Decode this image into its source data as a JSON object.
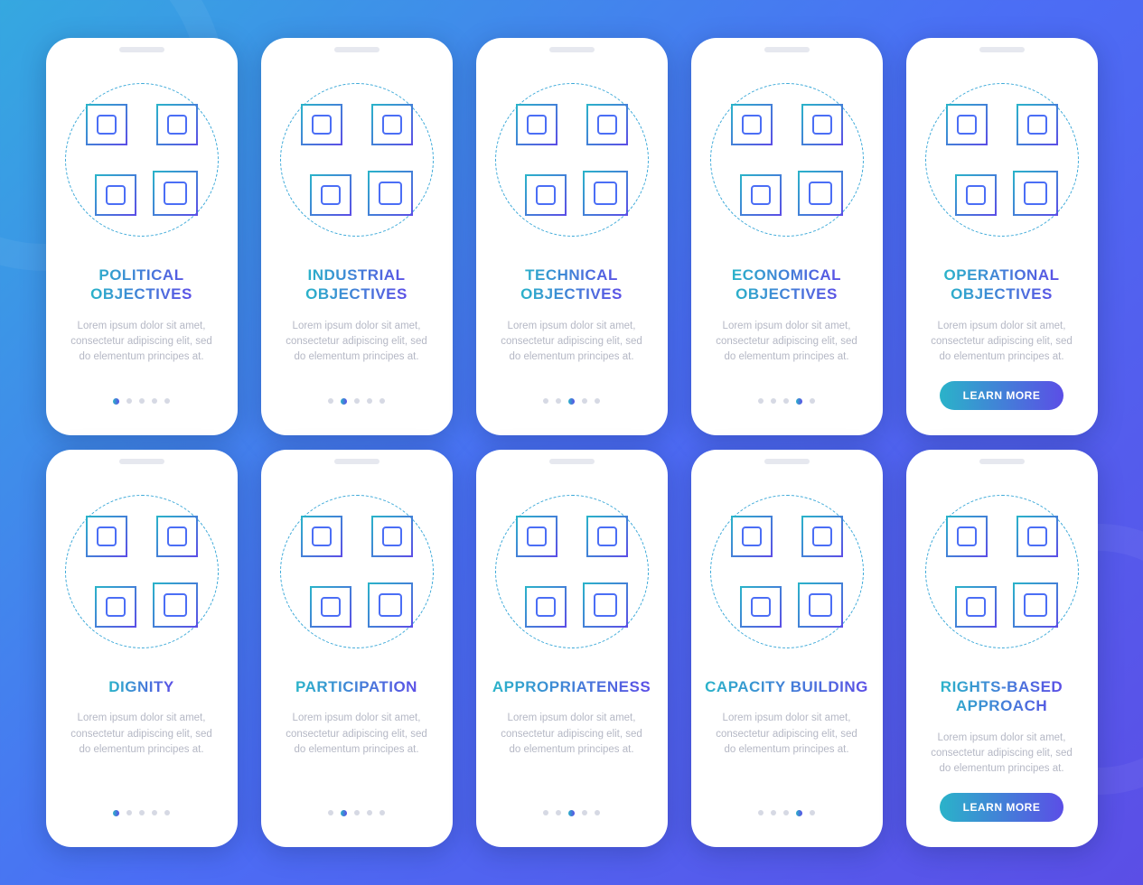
{
  "lorem": "Lorem ipsum dolor sit amet, consectetur adipiscing elit, sed do elementum principes at.",
  "learn_label": "LEARN MORE",
  "cards": [
    {
      "title": "POLITICAL\nOBJECTIVES",
      "active": 0,
      "cta": false
    },
    {
      "title": "INDUSTRIAL\nOBJECTIVES",
      "active": 1,
      "cta": false
    },
    {
      "title": "TECHNICAL\nOBJECTIVES",
      "active": 2,
      "cta": false
    },
    {
      "title": "ECONOMICAL\nOBJECTIVES",
      "active": 3,
      "cta": false
    },
    {
      "title": "OPERATIONAL\nOBJECTIVES",
      "active": -1,
      "cta": true
    },
    {
      "title": "DIGNITY",
      "active": 0,
      "cta": false
    },
    {
      "title": "PARTICIPATION",
      "active": 1,
      "cta": false
    },
    {
      "title": "APPROPRIATENESS",
      "active": 2,
      "cta": false
    },
    {
      "title": "CAPACITY BUILDING",
      "active": 3,
      "cta": false
    },
    {
      "title": "RIGHTS-BASED\nAPPROACH",
      "active": -1,
      "cta": true
    }
  ]
}
